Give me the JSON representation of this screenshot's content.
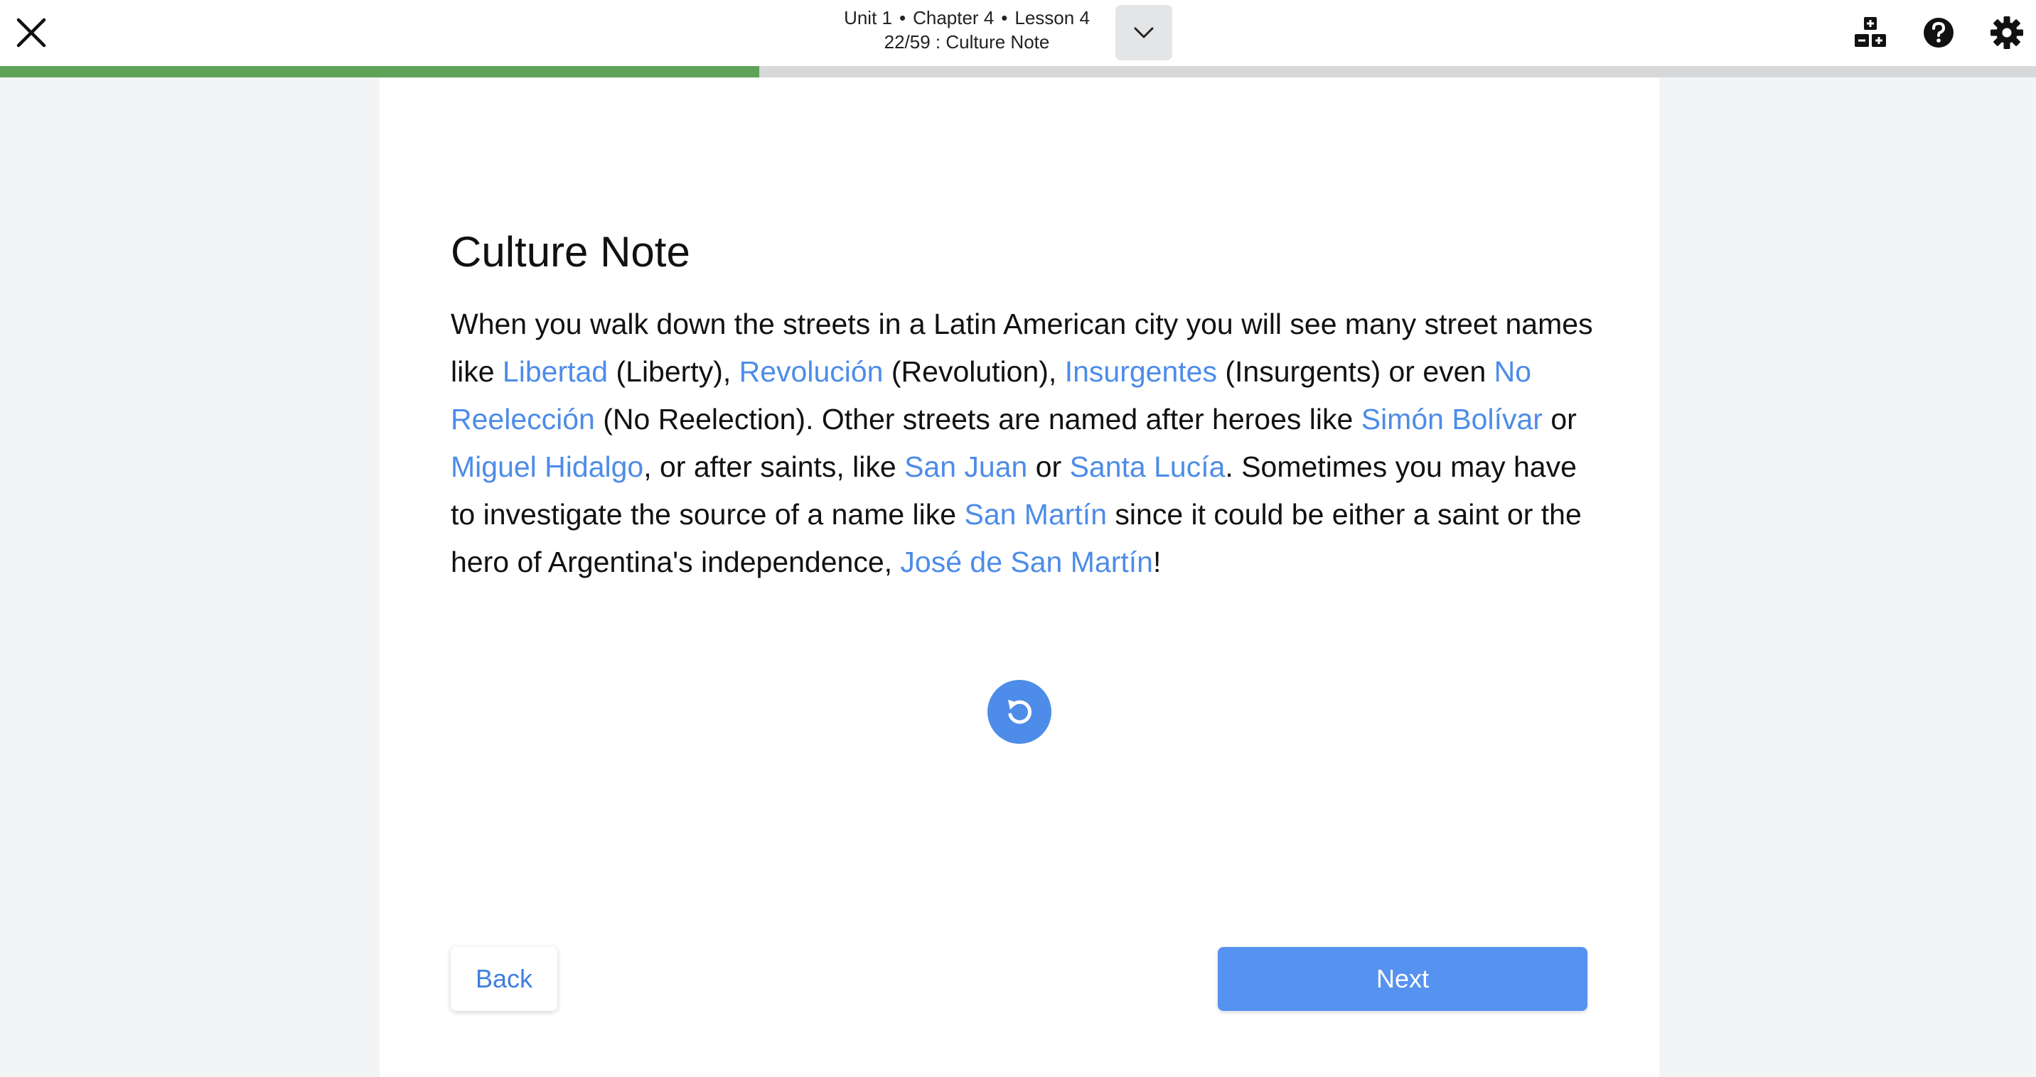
{
  "header": {
    "unit": "Unit 1",
    "chapter": "Chapter 4",
    "lesson": "Lesson 4",
    "separator": "•",
    "position": "22/59 : Culture Note"
  },
  "progress": {
    "fraction": 0.3729,
    "color": "#5fa35a",
    "track_color": "#d7d8d9"
  },
  "icons": {
    "close": "close-icon",
    "dropdown": "chevron-down-icon",
    "grid": "grid-plus-icon",
    "help": "help-icon",
    "settings": "gear-icon",
    "replay": "replay-icon"
  },
  "content": {
    "title": "Culture Note",
    "segments": [
      {
        "text": "When you walk down the streets in a Latin American city you will see many street names like "
      },
      {
        "text": "Libertad",
        "link": true
      },
      {
        "text": "  (Liberty), "
      },
      {
        "text": "Revolución",
        "link": true
      },
      {
        "text": " (Revolution), "
      },
      {
        "text": "Insurgentes",
        "link": true
      },
      {
        "text": " (Insurgents) or even "
      },
      {
        "text": "No Reelección",
        "link": true
      },
      {
        "text": " (No Reelection).  Other streets are named after heroes like "
      },
      {
        "text": "Simón Bolívar",
        "link": true
      },
      {
        "text": " or "
      },
      {
        "text": "Miguel Hidalgo",
        "link": true
      },
      {
        "text": ", or after saints, like "
      },
      {
        "text": "San Juan",
        "link": true
      },
      {
        "text": " or "
      },
      {
        "text": "Santa Lucía",
        "link": true
      },
      {
        "text": ". Sometimes you may have to investigate the source of a name like "
      },
      {
        "text": "San Martín",
        "link": true
      },
      {
        "text": " since it could be either a saint or the hero of Argentina's independence, "
      },
      {
        "text": "José de San Martín",
        "link": true
      },
      {
        "text": "!"
      }
    ]
  },
  "footer": {
    "back_label": "Back",
    "next_label": "Next"
  },
  "colors": {
    "link": "#4d8ce8",
    "primary": "#5692f0",
    "background": "#f3f4f5",
    "card": "#ffffff"
  }
}
